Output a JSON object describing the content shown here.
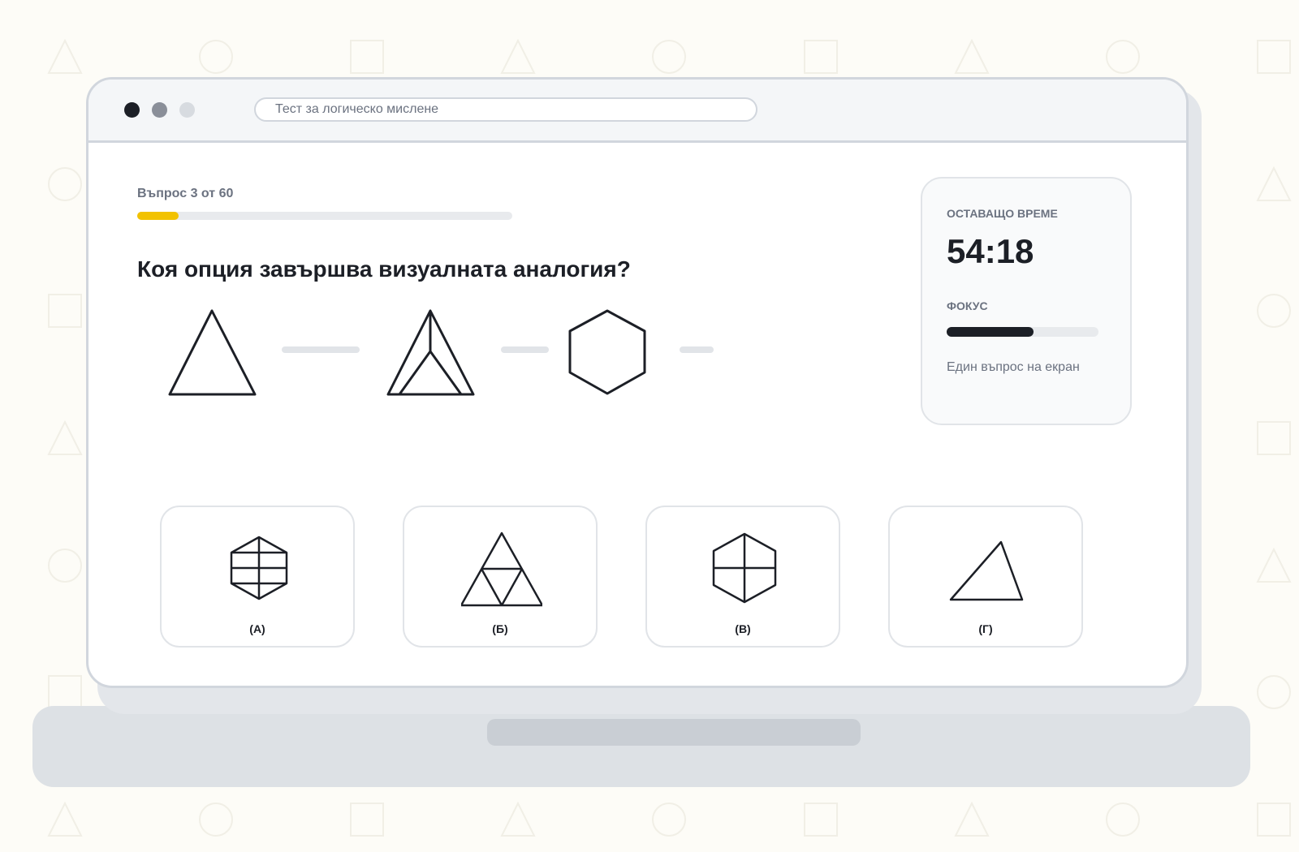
{
  "window": {
    "url_text": "Тест за логическо мислене"
  },
  "progress": {
    "label": "Въпрос 3 от 60",
    "fraction": 0.11
  },
  "question": {
    "text": "Коя опция завършва визуалната аналогия?"
  },
  "analogy_items": [
    {
      "icon": "triangle-icon"
    },
    {
      "icon": "dash-connector-icon"
    },
    {
      "icon": "divided-triangle-icon"
    },
    {
      "icon": "dash-connector-icon"
    },
    {
      "icon": "hexagon-icon"
    },
    {
      "icon": "dash-connector-icon"
    }
  ],
  "timer_card": {
    "time_label": "ОСТАВАЩО ВРЕМЕ",
    "time_value": "54:18",
    "focus_label": "ФОКУС",
    "focus_fraction": 0.57,
    "note": "Един въпрос на екран"
  },
  "options": [
    {
      "label": "(А)",
      "icon": "divided-hexagon-icon"
    },
    {
      "label": "(Б)",
      "icon": "subdivided-triangle-icon"
    },
    {
      "label": "(В)",
      "icon": "quartered-hexagon-icon"
    },
    {
      "label": "(Г)",
      "icon": "scalene-triangle-icon"
    }
  ],
  "colors": {
    "accent": "#f2c200",
    "ink": "#1c1f26",
    "muted": "#6b7280",
    "border": "#d1d6dd",
    "background": "#fdfcf7"
  }
}
